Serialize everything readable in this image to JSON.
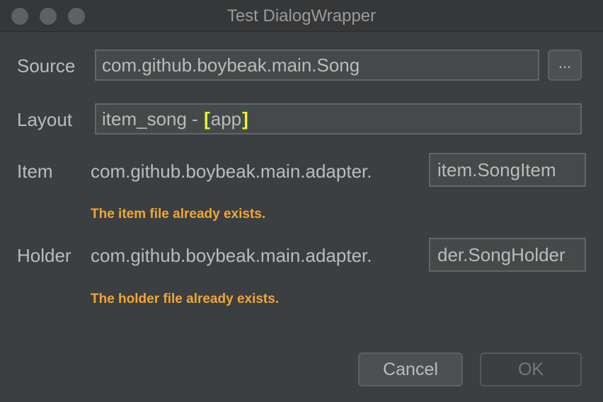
{
  "window": {
    "title": "Test DialogWrapper"
  },
  "source": {
    "label": "Source",
    "value": "com.github.boybeak.main.Song",
    "browse_label": "..."
  },
  "layout": {
    "label": "Layout",
    "value_prefix": "item_song - ",
    "bracket_open": "[",
    "module": "app",
    "bracket_close": "]"
  },
  "item": {
    "label": "Item",
    "package_prefix": "com.github.boybeak.main.adapter.",
    "value": "item.SongItem",
    "warning": "The item file already exists."
  },
  "holder": {
    "label": "Holder",
    "package_prefix": "com.github.boybeak.main.adapter.",
    "value": "der.SongHolder",
    "warning": "The holder file already exists."
  },
  "buttons": {
    "cancel": "Cancel",
    "ok": "OK"
  },
  "colors": {
    "background": "#3c3f41",
    "warning": "#f0a732",
    "bracket_highlight": "#ffef28"
  }
}
